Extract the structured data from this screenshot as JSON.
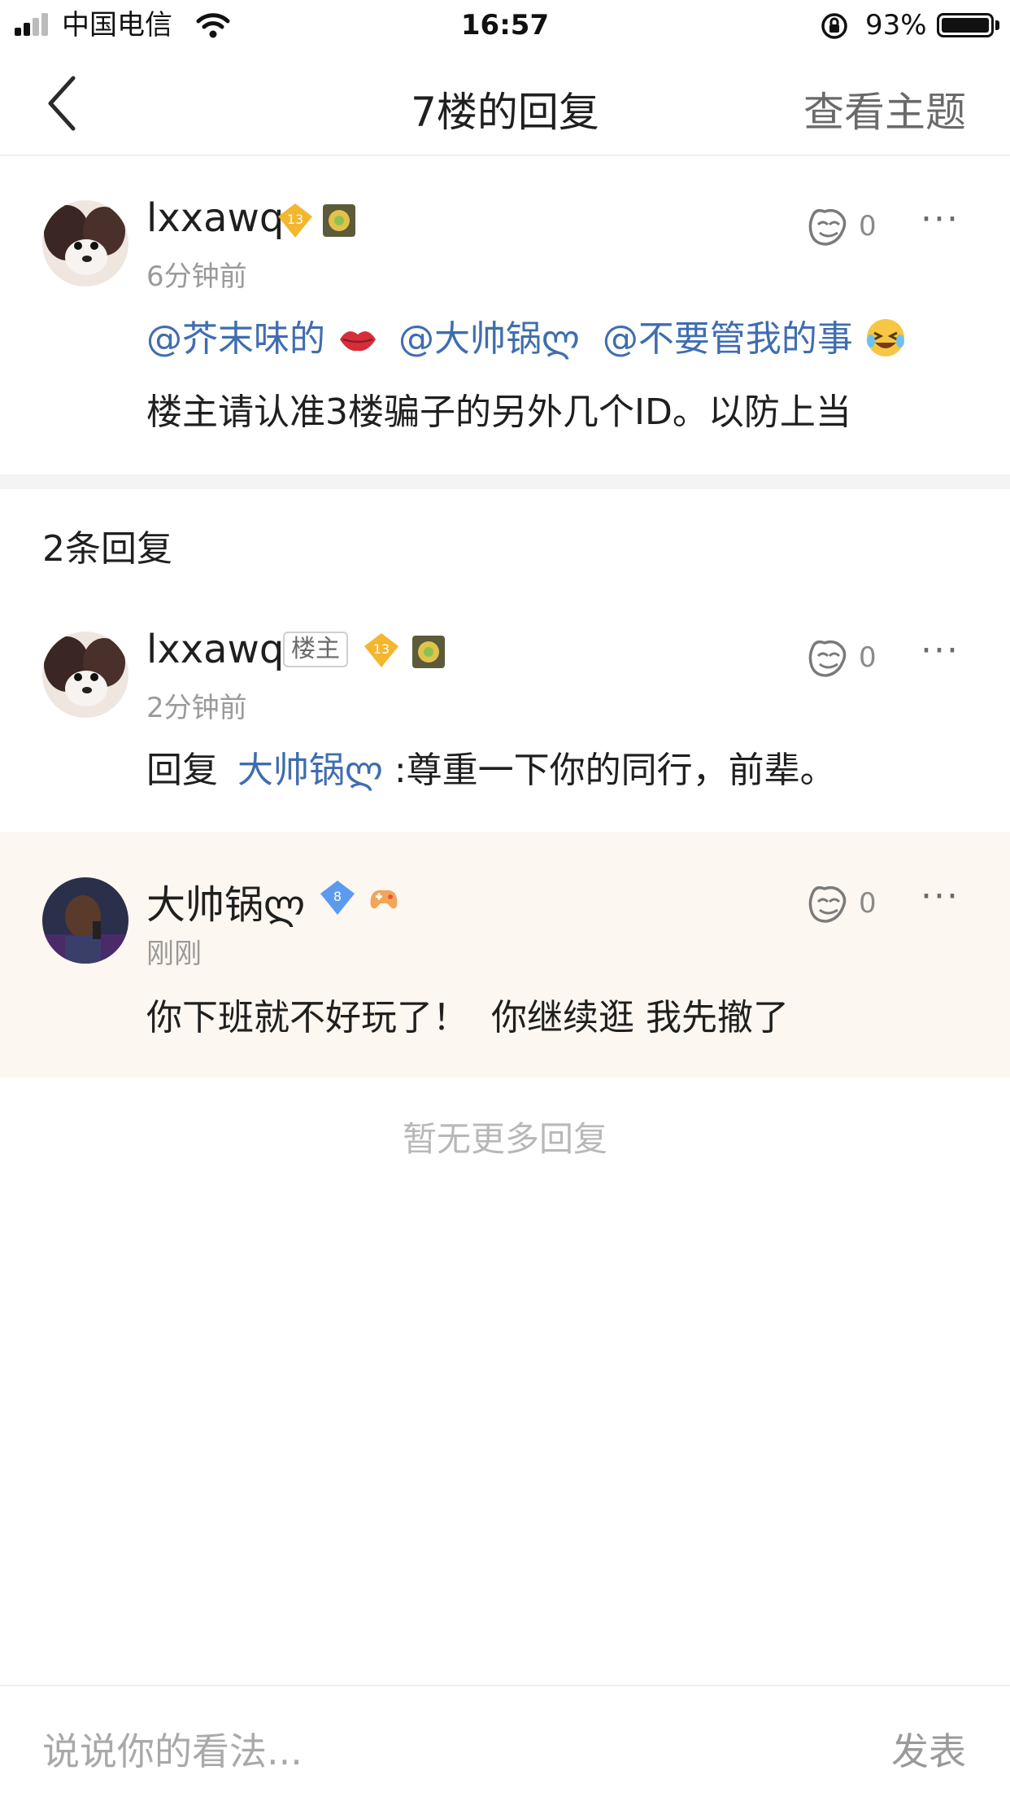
{
  "status_bar": {
    "carrier": "中国电信",
    "time": "16:57",
    "battery": "93%"
  },
  "nav": {
    "title": "7楼的回复",
    "right_action": "查看主题"
  },
  "main_post": {
    "username": "lxxawq",
    "level": "13",
    "time": "6分钟前",
    "likes": "0",
    "mentions": [
      "@芥末味的",
      "@大帅锅ლ",
      "@不要管我的事"
    ],
    "text": "楼主请认准3楼骗子的另外几个ID。以防上当"
  },
  "replies_header": "2条回复",
  "replies": [
    {
      "username": "lxxawq",
      "host_tag": "楼主",
      "level": "13",
      "time": "2分钟前",
      "likes": "0",
      "reply_prefix": "回复",
      "reply_to": "大帅锅ლ",
      "text": ":尊重一下你的同行，前辈。"
    },
    {
      "username": "大帅锅ლ",
      "level": "8",
      "time": "刚刚",
      "likes": "0",
      "text": "你下班就不好玩了！  你继续逛 我先撤了"
    }
  ],
  "no_more": "暂无更多回复",
  "bottom_bar": {
    "placeholder": "说说你的看法...",
    "send": "发表"
  },
  "colors": {
    "link": "#3f6db0",
    "highlight_bg": "#fdf7f1",
    "level_badge_gold": "#f4b62e",
    "level_badge_blue": "#5b9bef"
  }
}
